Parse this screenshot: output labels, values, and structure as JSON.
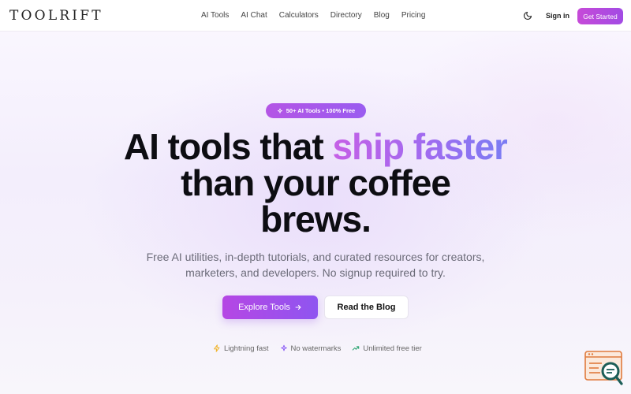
{
  "brand": {
    "logo_text": "TOOLRIFT"
  },
  "nav": {
    "links": [
      "AI Tools",
      "AI Chat",
      "Calculators",
      "Directory",
      "Blog",
      "Pricing"
    ],
    "sign_in": "Sign in",
    "get_started": "Get Started"
  },
  "hero": {
    "badge": "50+ AI Tools • 100% Free",
    "title_line1_plain": "AI tools that ",
    "title_line1_highlight": "ship faster",
    "title_line2": "than your coffee",
    "title_line3": "brews.",
    "subtitle_line1": "Free AI utilities, in-depth tutorials, and curated resources for creators,",
    "subtitle_line2": "marketers, and developers. No signup required to try.",
    "primary_button": "Explore Tools",
    "secondary_button": "Read the Blog"
  },
  "features": [
    {
      "label": "Lightning fast",
      "icon": "lightning-icon",
      "color": "#f0b429"
    },
    {
      "label": "No watermarks",
      "icon": "sparkle-icon",
      "color": "#8b5cf6"
    },
    {
      "label": "Unlimited free tier",
      "icon": "trending-up-icon",
      "color": "#22a06b"
    }
  ],
  "colors": {
    "accent_start": "#c64ad8",
    "accent_end": "#8f55f0"
  }
}
